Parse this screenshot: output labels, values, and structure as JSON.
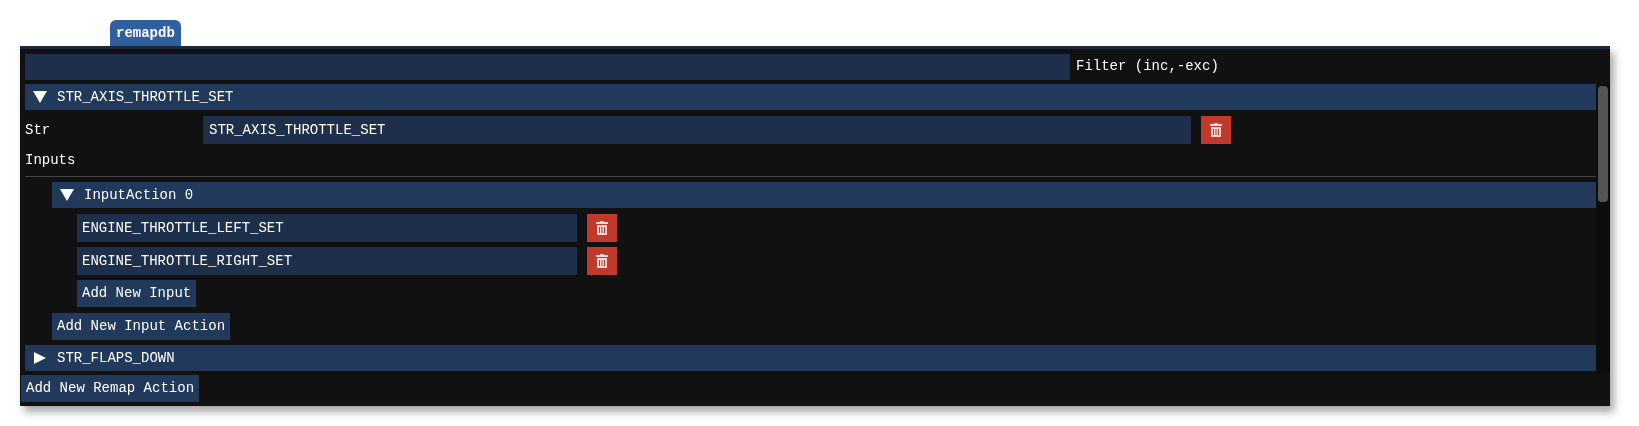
{
  "tab": {
    "label": "remapdb"
  },
  "filter": {
    "label": "Filter (inc,-exc)"
  },
  "remap_actions": [
    {
      "title": "STR_AXIS_THROTTLE_SET",
      "expanded": true,
      "str_label": "Str",
      "str_value": "STR_AXIS_THROTTLE_SET",
      "inputs_label": "Inputs",
      "children": [
        {
          "title": "InputAction 0",
          "expanded": true,
          "inputs": [
            "ENGINE_THROTTLE_LEFT_SET",
            "ENGINE_THROTTLE_RIGHT_SET"
          ],
          "add_button": "Add New Input"
        }
      ],
      "add_button": "Add New Input Action"
    },
    {
      "title": "STR_FLAPS_DOWN",
      "expanded": false
    }
  ],
  "add_button": "Add New Remap Action"
}
